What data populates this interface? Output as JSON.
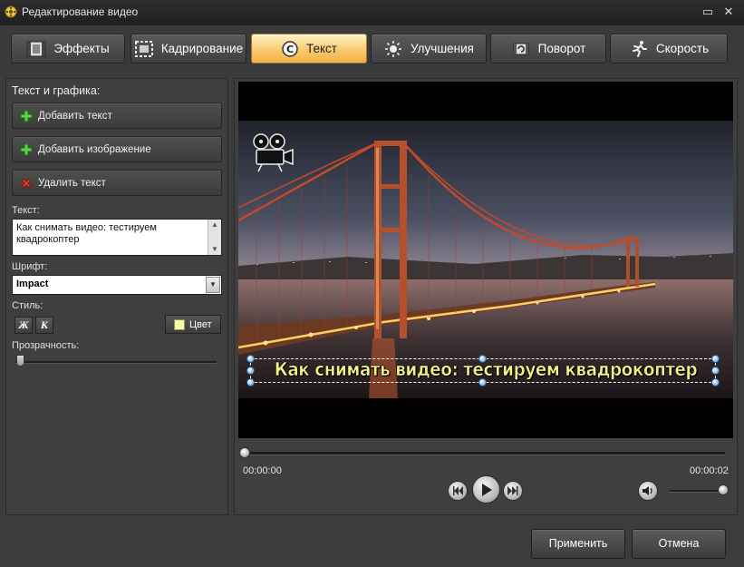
{
  "window": {
    "title": "Редактирование видео"
  },
  "tabs": [
    {
      "label": "Эффекты",
      "icon": "effects-icon"
    },
    {
      "label": "Кадрирование",
      "icon": "crop-icon"
    },
    {
      "label": "Текст",
      "icon": "text-icon",
      "active": true
    },
    {
      "label": "Улучшения",
      "icon": "enhance-icon"
    },
    {
      "label": "Поворот",
      "icon": "rotate-icon"
    },
    {
      "label": "Скорость",
      "icon": "speed-icon"
    }
  ],
  "left": {
    "section_title": "Текст и графика:",
    "add_text": "Добавить текст",
    "add_image": "Добавить изображение",
    "delete_text": "Удалить текст",
    "text_label": "Текст:",
    "text_value_line1": "Как снимать видео: тестируем",
    "text_value_line2": "квадрокоптер",
    "font_label": "Шрифт:",
    "font_value": "Impact",
    "style_label": "Стиль:",
    "bold_label": "Ж",
    "italic_label": "К",
    "color_label": "Цвет",
    "color_value": "#ffff99",
    "opacity_label": "Прозрачность:"
  },
  "preview": {
    "caption": "Как снимать видео: тестируем квадрокоптер",
    "time_current": "00:00:00",
    "time_total": "00:00:02",
    "volume_level": 1.0
  },
  "footer": {
    "apply": "Применить",
    "cancel": "Отмена"
  }
}
